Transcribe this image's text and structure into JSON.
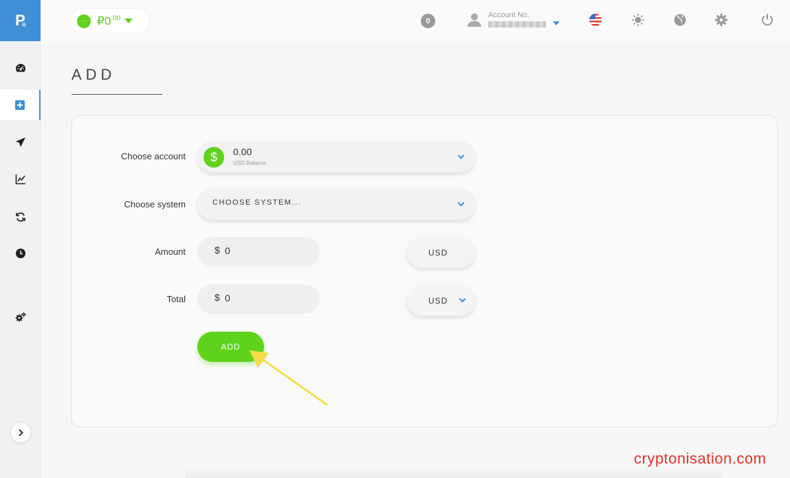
{
  "brand": {
    "logo_letter": "P",
    "logo_mark": "®"
  },
  "sidebar": {
    "items": [
      {
        "name": "dashboard",
        "icon": "gauge-icon"
      },
      {
        "name": "add",
        "icon": "plus-square-icon",
        "active": true
      },
      {
        "name": "send",
        "icon": "paper-plane-icon"
      },
      {
        "name": "stats",
        "icon": "chart-line-icon"
      },
      {
        "name": "exchange",
        "icon": "refresh-icon"
      },
      {
        "name": "history",
        "icon": "clock-icon"
      },
      {
        "name": "settings",
        "icon": "gears-icon"
      }
    ],
    "collapse_icon": "chevron-right-icon"
  },
  "topbar": {
    "balance_dot": "···",
    "balance_symbol": "₽",
    "balance_int": "0",
    "balance_dec": ".00",
    "notifications": "0",
    "account_label": "Account No.",
    "icons": [
      "flag-us-icon",
      "sun-icon",
      "globe-icon",
      "gear-icon",
      "power-icon"
    ]
  },
  "page": {
    "title": "ADD",
    "form": {
      "choose_account_label": "Choose account",
      "account_coin": "$",
      "account_amount": "0.00",
      "account_sub": "USD Balance",
      "choose_system_label": "Choose system",
      "system_placeholder": "CHOOSE SYSTEM...",
      "amount_label": "Amount",
      "amount_currency_sign": "$",
      "amount_value": "0",
      "amount_currency": "USD",
      "total_label": "Total",
      "total_currency_sign": "$",
      "total_value": "0",
      "total_currency": "USD",
      "add_button": "ADD"
    }
  },
  "watermark": "cryptonisation.com",
  "colors": {
    "accent_blue": "#3f8fd6",
    "green": "#5fd21c",
    "arrow_yellow": "#f5dc4a",
    "watermark_red": "#e0322a"
  }
}
